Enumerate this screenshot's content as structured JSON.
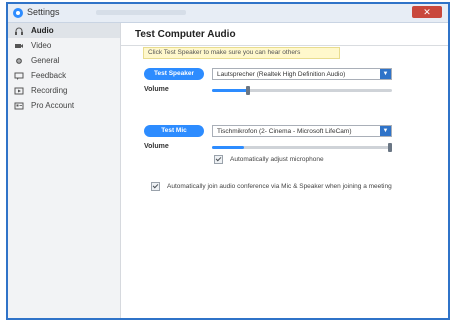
{
  "window": {
    "title": "Settings",
    "close_label": "✕"
  },
  "sidebar": {
    "items": [
      {
        "label": "Audio",
        "icon": "headphones-icon"
      },
      {
        "label": "Video",
        "icon": "video-camera-icon"
      },
      {
        "label": "General",
        "icon": "gear-icon"
      },
      {
        "label": "Feedback",
        "icon": "feedback-icon"
      },
      {
        "label": "Recording",
        "icon": "recording-icon"
      },
      {
        "label": "Pro Account",
        "icon": "account-icon"
      }
    ]
  },
  "main": {
    "title": "Test Computer Audio",
    "tip": "Click Test Speaker to make sure you can hear others",
    "speaker": {
      "button_label": "Test Speaker",
      "device": "Lautsprecher (Realtek High Definition Audio)",
      "volume_label": "Volume",
      "volume_level": 0.2
    },
    "mic": {
      "button_label": "Test Mic",
      "device": "Tischmikrofon (2- Cinema - Microsoft LifeCam)",
      "volume_label": "Volume",
      "volume_level": 0.18,
      "auto_adjust_label": "Automatically adjust microphone",
      "auto_adjust_checked": true
    },
    "auto_join_label": "Automatically join audio conference via Mic & Speaker when joining a meeting",
    "auto_join_checked": true
  }
}
